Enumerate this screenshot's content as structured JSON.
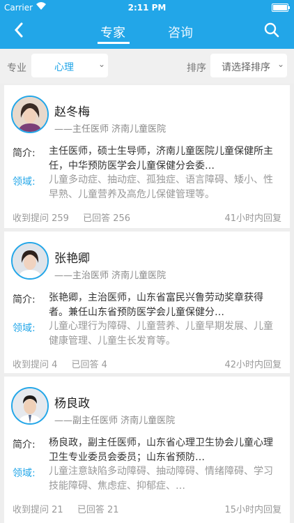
{
  "status": {
    "carrier": "Carrier",
    "time": "2:11 PM"
  },
  "nav": {
    "tab_expert": "专家",
    "tab_consult": "咨询"
  },
  "filter": {
    "specialty_label": "专业",
    "specialty_value": "心理",
    "sort_label": "排序",
    "sort_placeholder": "请选择排序"
  },
  "labels": {
    "intro": "简介:",
    "field": "领域:"
  },
  "experts": [
    {
      "name": "赵冬梅",
      "title": "——主任医师 济南儿童医院",
      "intro": "主任医师，硕士生导师，济南儿童医院儿童保健所主任，中华预防医学会儿童保健分会委…",
      "field": "儿童多动症、抽动症、孤独症、语言障碍、矮小、性早熟、儿童营养及高危儿保健管理等。",
      "questions": "收到提问 259",
      "answered": "已回答 256",
      "reply": "41小时内回复"
    },
    {
      "name": "张艳卿",
      "title": "——主治医师 济南儿童医院",
      "intro": "张艳卿，主治医师，山东省富民兴鲁劳动奖章获得者。兼任山东省预防医学会儿童保健分…",
      "field": "儿童心理行为障碍、儿童营养、儿童早期发展、儿童健康管理、儿童生长发育等。",
      "questions": "收到提问 4",
      "answered": "已回答 4",
      "reply": "42小时内回复"
    },
    {
      "name": "杨良政",
      "title": "——副主任医师 济南儿童医院",
      "intro": "杨良政，副主任医师，山东省心理卫生协会儿童心理卫生专业委员会委员；山东省预防…",
      "field": "儿童注意缺陷多动障碍、抽动障碍、情绪障碍、学习技能障碍、焦虑症、抑郁症、…",
      "questions": "收到提问 21",
      "answered": "已回答 21",
      "reply": "15小时内回复"
    }
  ],
  "colors": {
    "accent": "#22a6e8",
    "background": "#eeeeee"
  }
}
